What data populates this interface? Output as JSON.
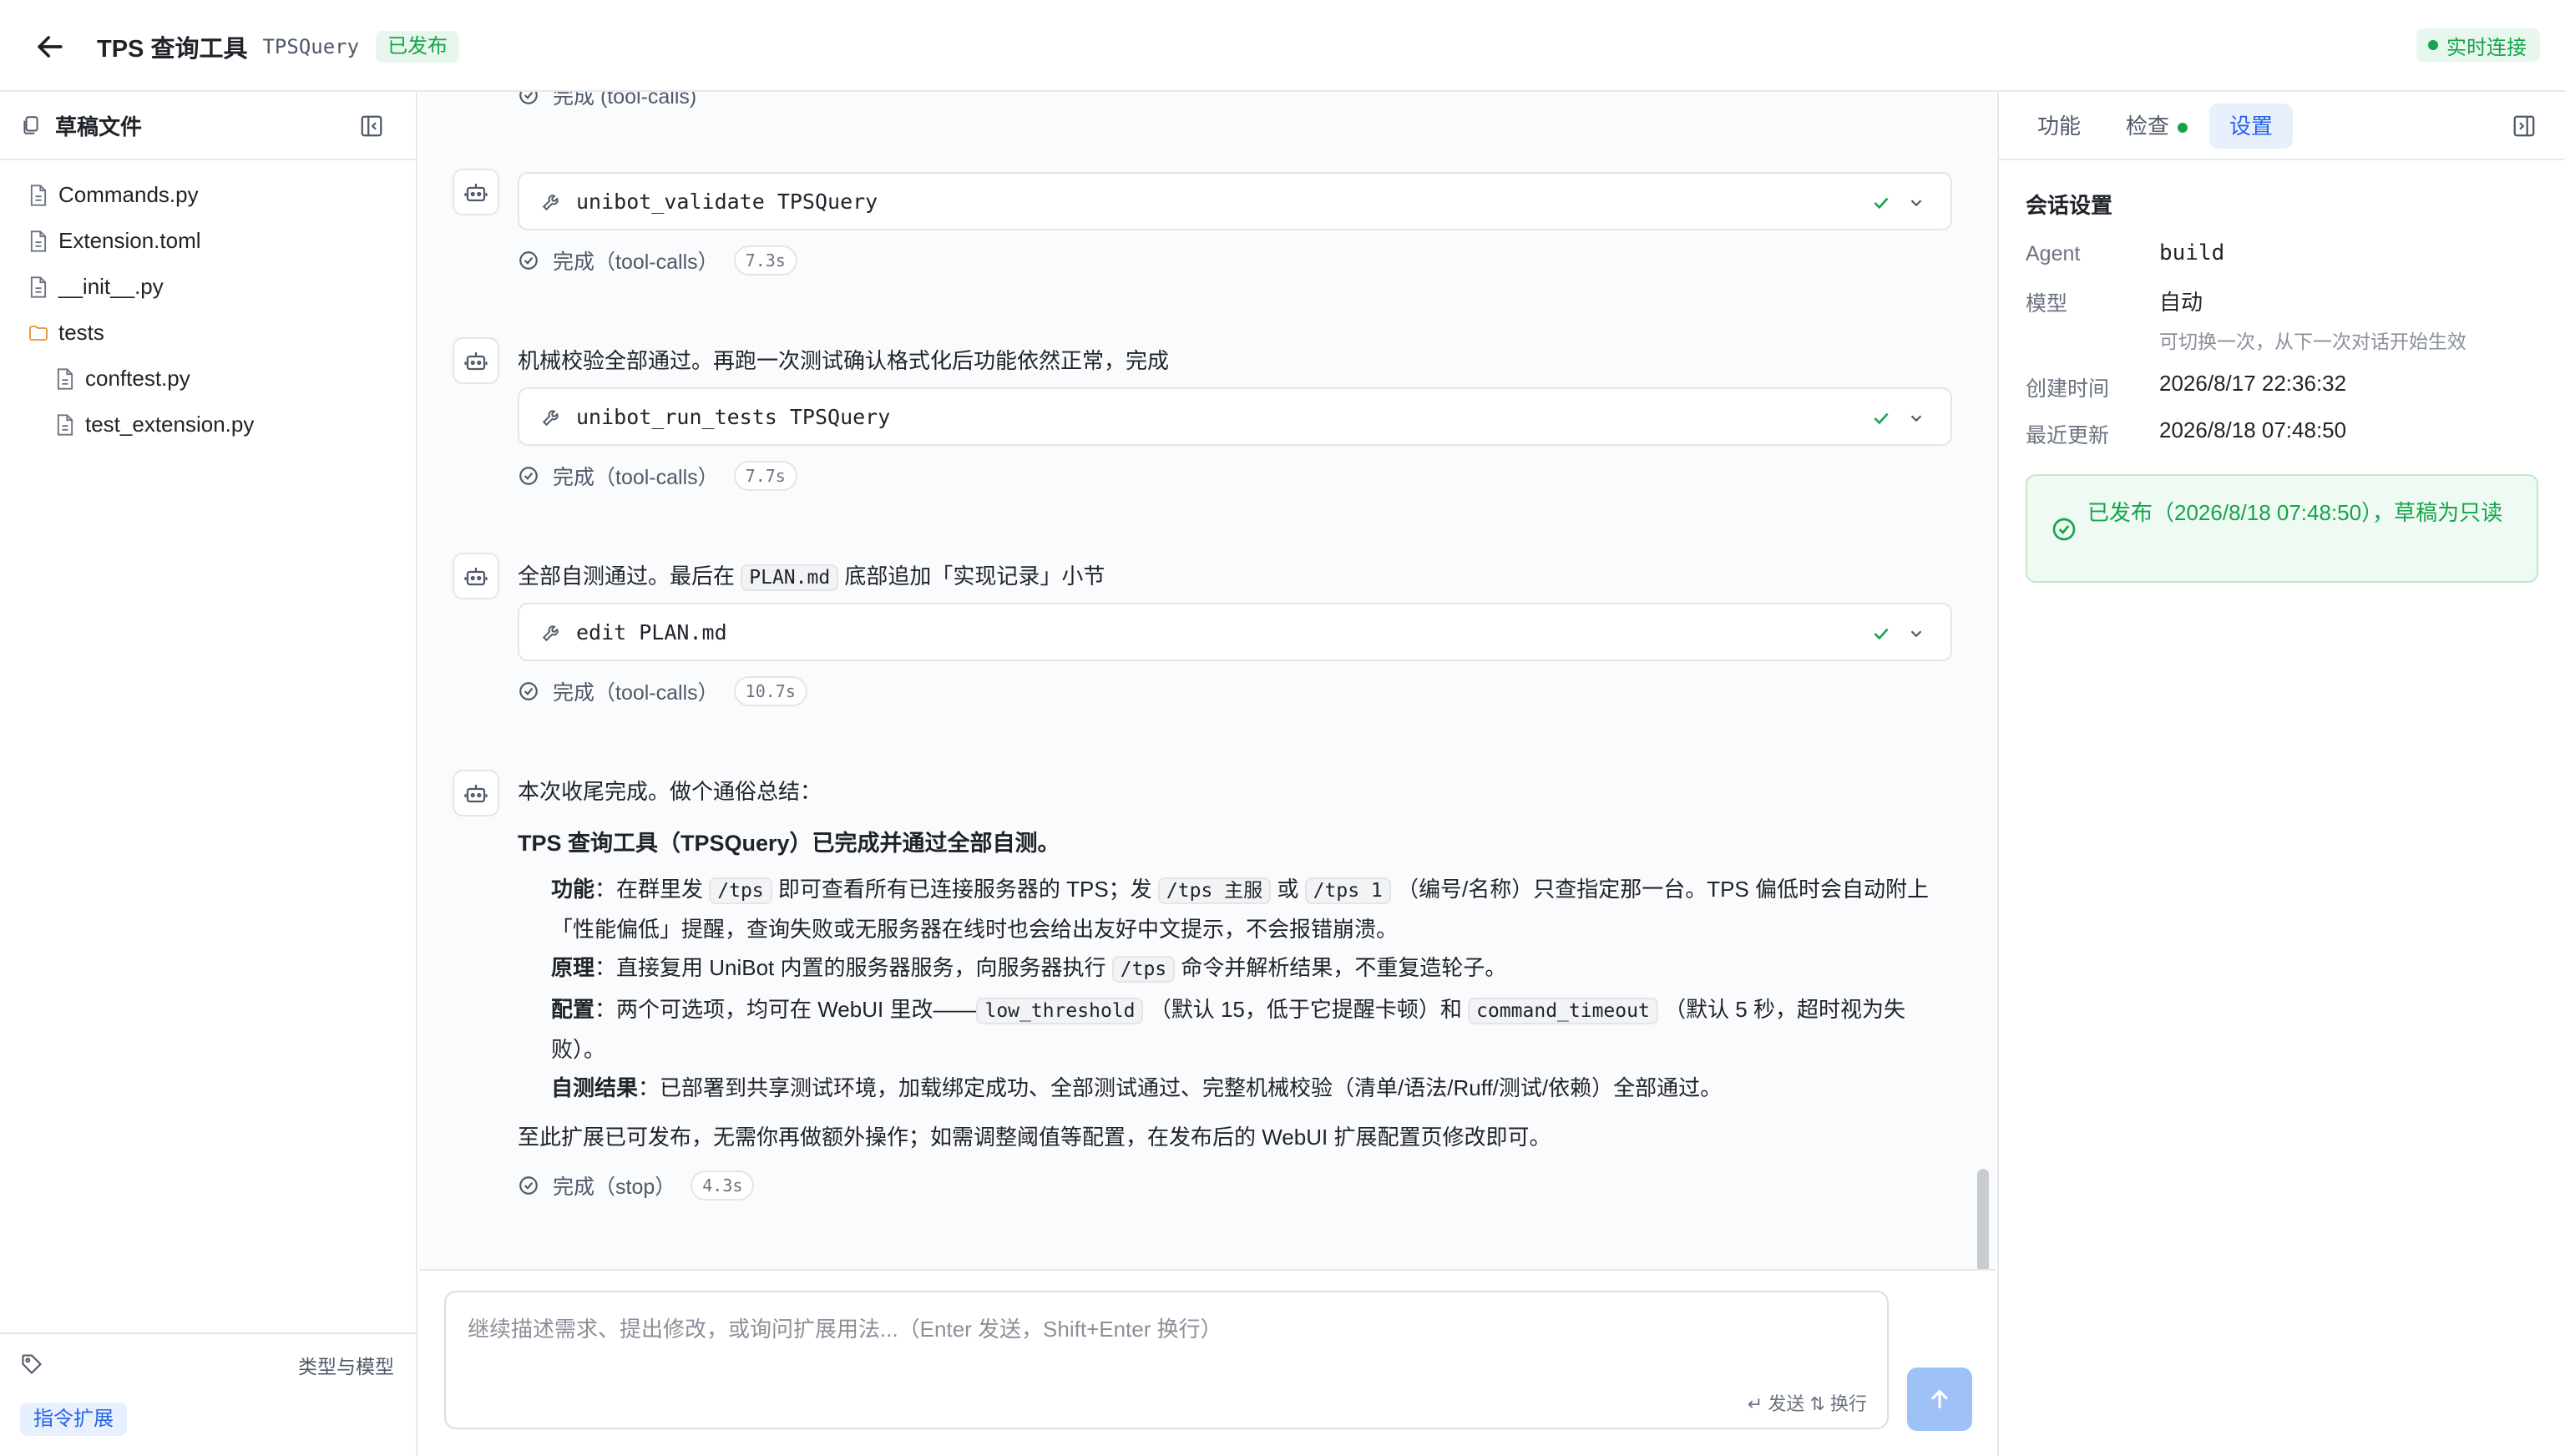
{
  "header": {
    "title": "TPS 查询工具",
    "id": "TPSQuery",
    "badge": "已发布",
    "live": "实时连接"
  },
  "sidebar": {
    "title": "草稿文件",
    "files": [
      {
        "name": "Commands.py",
        "type": "file"
      },
      {
        "name": "Extension.toml",
        "type": "file"
      },
      {
        "name": "__init__.py",
        "type": "file"
      },
      {
        "name": "tests",
        "type": "folder"
      },
      {
        "name": "conftest.py",
        "type": "file",
        "child": true
      },
      {
        "name": "test_extension.py",
        "type": "file",
        "child": true
      }
    ],
    "footer_label": "类型与模型",
    "footer_chip": "指令扩展"
  },
  "chat": {
    "top_partial": "完成 (tool-calls)",
    "messages": [
      {
        "tool": "unibot_validate TPSQuery",
        "status": "完成（tool-calls）",
        "duration": "7.3s"
      },
      {
        "text": "机械校验全部通过。再跑一次测试确认格式化后功能依然正常，完成",
        "tool": "unibot_run_tests TPSQuery",
        "status": "完成（tool-calls）",
        "duration": "7.7s"
      },
      {
        "text_a": "全部自测通过。最后在",
        "code": "PLAN.md",
        "text_b": "底部追加「实现记录」小节",
        "tool": "edit PLAN.md",
        "status": "完成（tool-calls）",
        "duration": "10.7s"
      }
    ],
    "summary": {
      "intro": "本次收尾完成。做个通俗总结：",
      "headline": "TPS 查询工具（TPSQuery）已完成并通过全部自测。",
      "bullets": {
        "func_label": "功能",
        "func_a": "：在群里发",
        "func_code1": "/tps",
        "func_b": "即可查看所有已连接服务器的 TPS；发",
        "func_code2": "/tps 主服",
        "func_c": "或",
        "func_code3": "/tps 1",
        "func_d": "（编号/名称）只查指定那一台。TPS 偏低时会自动附上",
        "func_e": "「性能偏低」提醒，查询失败或无服务器在线时也会给出友好中文提示，不会报错崩溃。",
        "prin_label": "原理",
        "prin_a": "：直接复用 UniBot 内置的服务器服务，向服务器执行",
        "prin_code": "/tps",
        "prin_b": "命令并解析结果，不重复造轮子。",
        "conf_label": "配置",
        "conf_a": "：两个可选项，均可在 WebUI 里改——",
        "conf_code1": "low_threshold",
        "conf_b": "（默认 15，低于它提醒卡顿）和",
        "conf_code2": "command_timeout",
        "conf_c": "（默认 5 秒，超时视为失",
        "conf_d": "败）。",
        "test_label": "自测结果",
        "test_a": "：已部署到共享测试环境，加载绑定成功、全部测试通过、完整机械校验（清单/语法/Ruff/测试/依赖）全部通过。"
      },
      "closing": "至此扩展已可发布，无需你再做额外操作；如需调整阈值等配置，在发布后的 WebUI 扩展配置页修改即可。",
      "status": "完成（stop）",
      "duration": "4.3s"
    },
    "input": {
      "placeholder": "继续描述需求、提出修改，或询问扩展用法...（Enter 发送，Shift+Enter 换行）",
      "hint": "↵ 发送 ⇅ 换行"
    }
  },
  "panel": {
    "tabs": [
      "功能",
      "检查",
      "设置"
    ],
    "active_tab": "设置",
    "section": "会话设置",
    "rows": {
      "agent_label": "Agent",
      "agent_value": "build",
      "model_label": "模型",
      "model_value": "自动",
      "model_note": "可切换一次，从下一次对话开始生效",
      "created_label": "创建时间",
      "created_value": "2026/8/17 22:36:32",
      "updated_label": "最近更新",
      "updated_value": "2026/8/18 07:48:50"
    },
    "published_note": "已发布（2026/8/18 07:48:50），草稿为只读"
  },
  "colors": {
    "accent": "#2563eb",
    "success": "#16a34a",
    "send": "#9ec2f7"
  }
}
